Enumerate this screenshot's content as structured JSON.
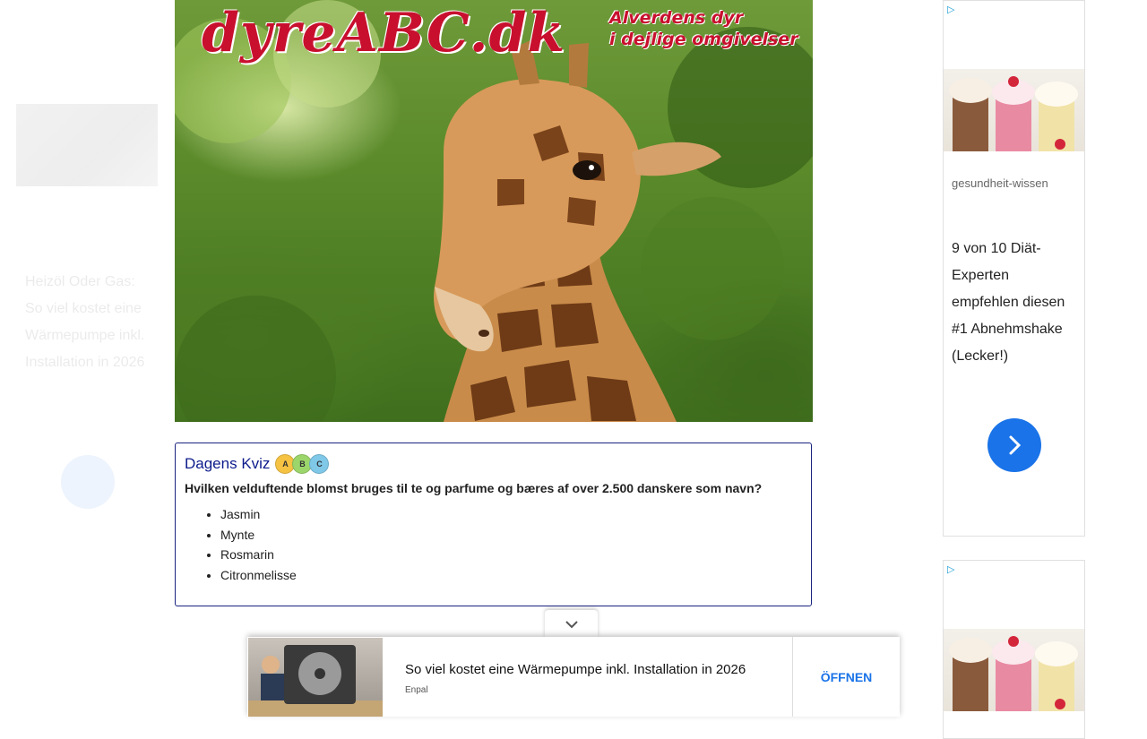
{
  "banner": {
    "logo_text": "dyreABC.dk",
    "tagline_line1": "Alverdens dyr",
    "tagline_line2": "i dejlige omgivelser"
  },
  "left_ad": {
    "text": "Heizöl Oder Gas: So viel kostet eine Wärmepumpe inkl. Installation in 2026"
  },
  "quiz": {
    "title": "Dagens Kviz",
    "badge_letters": [
      "A",
      "B",
      "C"
    ],
    "question": "Hvilken velduftende blomst bruges til te og parfume og bæres af over 2.500 danskere som navn?",
    "options": [
      "Jasmin",
      "Mynte",
      "Rosmarin",
      "Citronmelisse"
    ]
  },
  "right_ad": {
    "adchoices_icon": "adchoices-icon",
    "source": "gesundheit-wissen",
    "headline": "9 von 10 Diät-Experten empfehlen diesen #1 Abnehmshake (Lecker!)",
    "arrow_icon": "chevron-right-icon"
  },
  "sticky_ad": {
    "title": "So viel kostet eine Wärmepumpe inkl. Installation in 2026",
    "brand": "Enpal",
    "cta": "ÖFFNEN",
    "collapse_icon": "chevron-down-icon"
  },
  "colors": {
    "brand_red": "#c8102e",
    "quiz_border": "#1a237e",
    "quiz_title": "#0d1b8c",
    "ad_blue": "#1a73e8"
  }
}
